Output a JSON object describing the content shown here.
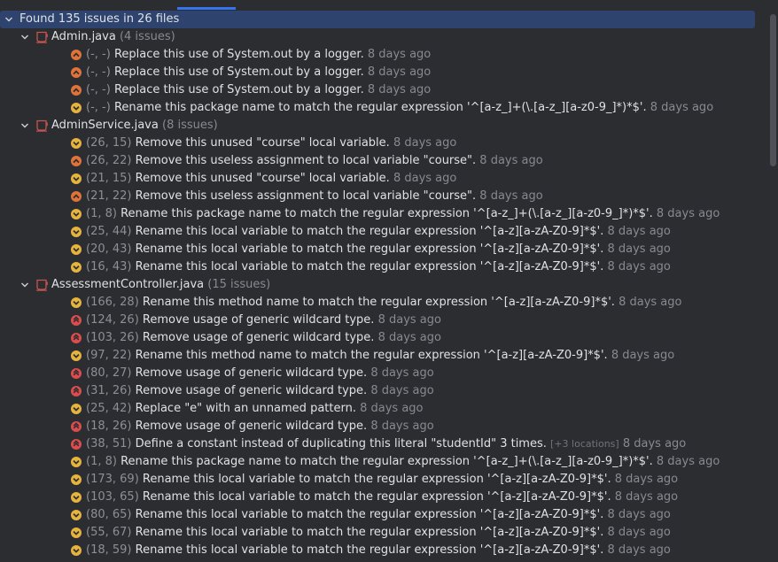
{
  "root": {
    "label": "Found 135 issues in 26 files"
  },
  "files": [
    {
      "name": "Admin.java",
      "count": "(4 issues)",
      "issues": [
        {
          "severity": "major",
          "pos": "(-, -)",
          "msg": "Replace this use of System.out by a logger.",
          "time": "8 days ago"
        },
        {
          "severity": "major",
          "pos": "(-, -)",
          "msg": "Replace this use of System.out by a logger.",
          "time": "8 days ago"
        },
        {
          "severity": "major",
          "pos": "(-, -)",
          "msg": "Replace this use of System.out by a logger.",
          "time": "8 days ago"
        },
        {
          "severity": "minor",
          "pos": "(-, -)",
          "msg": "Rename this package name to match the regular expression '^[a-z_]+(\\.[a-z_][a-z0-9_]*)*$'.",
          "time": "8 days ago"
        }
      ]
    },
    {
      "name": "AdminService.java",
      "count": "(8 issues)",
      "issues": [
        {
          "severity": "minor",
          "pos": "(26, 15)",
          "msg": "Remove this unused \"course\" local variable.",
          "time": "8 days ago"
        },
        {
          "severity": "major",
          "pos": "(26, 22)",
          "msg": "Remove this useless assignment to local variable \"course\".",
          "time": "8 days ago"
        },
        {
          "severity": "minor",
          "pos": "(21, 15)",
          "msg": "Remove this unused \"course\" local variable.",
          "time": "8 days ago"
        },
        {
          "severity": "major",
          "pos": "(21, 22)",
          "msg": "Remove this useless assignment to local variable \"course\".",
          "time": "8 days ago"
        },
        {
          "severity": "minor",
          "pos": "(1, 8)",
          "msg": "Rename this package name to match the regular expression '^[a-z_]+(\\.[a-z_][a-z0-9_]*)*$'.",
          "time": "8 days ago"
        },
        {
          "severity": "minor",
          "pos": "(25, 44)",
          "msg": "Rename this local variable to match the regular expression '^[a-z][a-zA-Z0-9]*$'.",
          "time": "8 days ago"
        },
        {
          "severity": "minor",
          "pos": "(20, 43)",
          "msg": "Rename this local variable to match the regular expression '^[a-z][a-zA-Z0-9]*$'.",
          "time": "8 days ago"
        },
        {
          "severity": "minor",
          "pos": "(16, 43)",
          "msg": "Rename this local variable to match the regular expression '^[a-z][a-zA-Z0-9]*$'.",
          "time": "8 days ago"
        }
      ]
    },
    {
      "name": "AssessmentController.java",
      "count": "(15 issues)",
      "issues": [
        {
          "severity": "minor",
          "pos": "(166, 28)",
          "msg": "Rename this method name to match the regular expression '^[a-z][a-zA-Z0-9]*$'.",
          "time": "8 days ago"
        },
        {
          "severity": "critical",
          "pos": "(124, 26)",
          "msg": "Remove usage of generic wildcard type.",
          "time": "8 days ago"
        },
        {
          "severity": "critical",
          "pos": "(103, 26)",
          "msg": "Remove usage of generic wildcard type.",
          "time": "8 days ago"
        },
        {
          "severity": "minor",
          "pos": "(97, 22)",
          "msg": "Rename this method name to match the regular expression '^[a-z][a-zA-Z0-9]*$'.",
          "time": "8 days ago"
        },
        {
          "severity": "critical",
          "pos": "(80, 27)",
          "msg": "Remove usage of generic wildcard type.",
          "time": "8 days ago"
        },
        {
          "severity": "critical",
          "pos": "(31, 26)",
          "msg": "Remove usage of generic wildcard type.",
          "time": "8 days ago"
        },
        {
          "severity": "minor",
          "pos": "(25, 42)",
          "msg": "Replace \"e\" with an unnamed pattern.",
          "time": "8 days ago"
        },
        {
          "severity": "critical",
          "pos": "(18, 26)",
          "msg": "Remove usage of generic wildcard type.",
          "time": "8 days ago"
        },
        {
          "severity": "critical",
          "pos": "(38, 51)",
          "msg": "Define a constant instead of duplicating this literal \"studentId\" 3 times.",
          "extra": "[+3 locations]",
          "time": "8 days ago"
        },
        {
          "severity": "minor",
          "pos": "(1, 8)",
          "msg": "Rename this package name to match the regular expression '^[a-z_]+(\\.[a-z_][a-z0-9_]*)*$'.",
          "time": "8 days ago"
        },
        {
          "severity": "minor",
          "pos": "(173, 69)",
          "msg": "Rename this local variable to match the regular expression '^[a-z][a-zA-Z0-9]*$'.",
          "time": "8 days ago"
        },
        {
          "severity": "minor",
          "pos": "(103, 65)",
          "msg": "Rename this local variable to match the regular expression '^[a-z][a-zA-Z0-9]*$'.",
          "time": "8 days ago"
        },
        {
          "severity": "minor",
          "pos": "(80, 65)",
          "msg": "Rename this local variable to match the regular expression '^[a-z][a-zA-Z0-9]*$'.",
          "time": "8 days ago"
        },
        {
          "severity": "minor",
          "pos": "(55, 67)",
          "msg": "Rename this local variable to match the regular expression '^[a-z][a-zA-Z0-9]*$'.",
          "time": "8 days ago"
        },
        {
          "severity": "minor",
          "pos": "(18, 59)",
          "msg": "Rename this local variable to match the regular expression '^[a-z][a-zA-Z0-9]*$'.",
          "time": "8 days ago"
        }
      ]
    }
  ],
  "colors": {
    "major": "#e0733a",
    "minor": "#e5b33e",
    "critical": "#db4d4d",
    "file_icon": "#c75450",
    "selection": "#2e436e"
  },
  "icons": {
    "expand": "chevron-down-icon",
    "file": "java-file-icon",
    "major": "severity-major-icon",
    "minor": "severity-minor-icon",
    "critical": "severity-critical-icon"
  }
}
